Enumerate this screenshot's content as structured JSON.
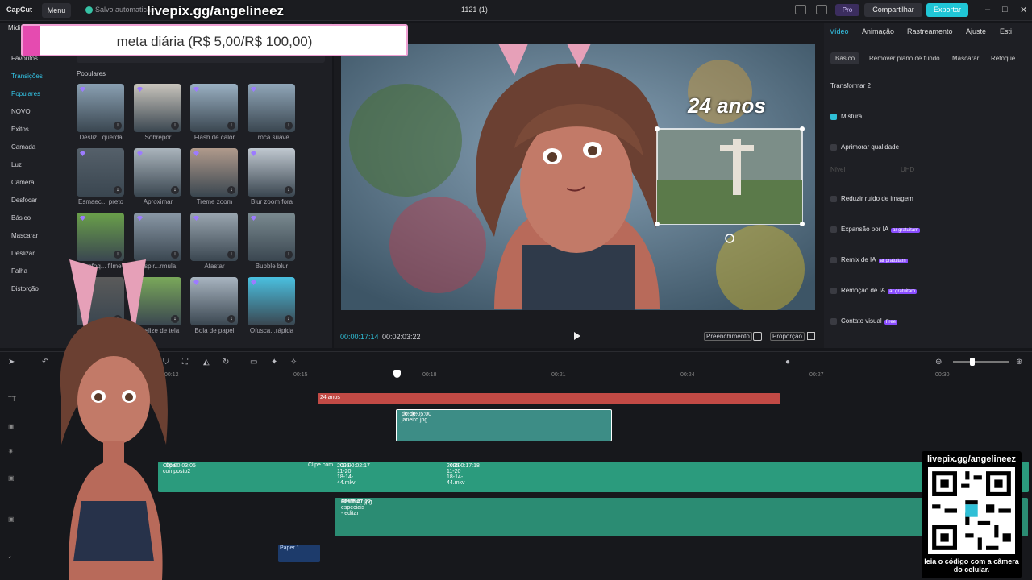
{
  "topbar": {
    "logo": "CapCut",
    "menu_label": "Menu",
    "saved_status": "Salvo automaticam",
    "project_name": "1121 (1)",
    "pro_label": "Pro",
    "share_label": "Compartilhar",
    "export_label": "Exportar"
  },
  "overlay": {
    "stream_url": "livepix.gg/angelineez",
    "goal_text": "meta diária (R$ 5,00/R$ 100,00)"
  },
  "left_panel": {
    "media_tab": "Mídi",
    "categories": [
      "Favoritos",
      "Transições",
      "Populares",
      "NOVO",
      "Exitos",
      "Camada",
      "Luz",
      "Câmera",
      "Desfocar",
      "Básico",
      "Mascarar",
      "Deslizar",
      "Falha",
      "Distorção"
    ],
    "section_title": "Populares",
    "transitions": [
      {
        "label": "Desliz...querda"
      },
      {
        "label": "Sobrepor"
      },
      {
        "label": "Flash de calor"
      },
      {
        "label": "Troca suave"
      },
      {
        "label": "Esmaec... preto"
      },
      {
        "label": "Aproximar"
      },
      {
        "label": "Treme zoom"
      },
      {
        "label": "Blur zoom fora"
      },
      {
        "label": "Desfoq... filme"
      },
      {
        "label": "Espir...rmula"
      },
      {
        "label": "Afastar"
      },
      {
        "label": "Bubble blur"
      },
      {
        "label": ""
      },
      {
        "label": "Deslize de tela"
      },
      {
        "label": "Bola de papel"
      },
      {
        "label": "Ofusca...rápida"
      }
    ]
  },
  "preview": {
    "title_overlay": "24 anos",
    "current_time": "00:00:17:14",
    "total_time": "00:02:03:22",
    "fill_label": "Preenchimento",
    "ratio_label": "Proporção"
  },
  "right_panel": {
    "tabs": [
      "Vídeo",
      "Animação",
      "Rastreamento",
      "Ajuste",
      "Esti"
    ],
    "subtabs": [
      "Básico",
      "Remover plano de fundo",
      "Mascarar",
      "Retoque"
    ],
    "transform_label": "Transformar 2",
    "blend_label": "Mistura",
    "enhance_label": "Aprimorar qualidade",
    "level_label": "Nível",
    "level_value": "UHD",
    "noise_label": "Reduzir ruído de imagem",
    "ai_expand_label": "Expansão por IA",
    "ai_remix_label": "Remix de IA",
    "ai_remove_label": "Remoção de IA",
    "free_tag": "ar gratuitam",
    "contact_label": "Contato visual",
    "contact_tag": "Free"
  },
  "timeline": {
    "ruler": [
      "00:12",
      "00:15",
      "00:18",
      "00:21",
      "00:24",
      "00:27",
      "00:30"
    ],
    "text_clip": "24 anos",
    "image_clip_name": "rio-de-janeiro.jpg",
    "image_clip_duration": "00:00:05:00",
    "main_clips": [
      {
        "name": "Clipe composto2",
        "duration": "00:00:03:05"
      },
      {
        "name": "Clipe com",
        "duration": ""
      },
      {
        "name": "2025-11-20 18-14-44.mkv",
        "duration": "00:00:02:17"
      },
      {
        "name": "2025-11-20 18-14-44.mkv",
        "duration": "00:00:17:18"
      }
    ],
    "fx_clip": "Efeitos especiais - editar",
    "fx_file": "1217521.jpg",
    "fx_duration": "00:01:47:22",
    "paper_clip": "Paper 1"
  },
  "qr": {
    "url": "livepix.gg/angelineez",
    "caption": "leia o código com a câmera do celular."
  }
}
